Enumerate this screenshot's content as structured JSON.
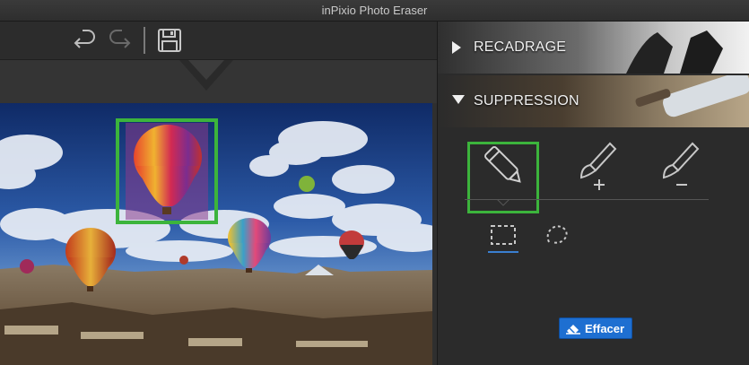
{
  "window": {
    "title": "inPixio Photo Eraser"
  },
  "toolbar": {
    "undo_icon": "undo-icon",
    "redo_icon": "redo-icon",
    "save_icon": "save-icon"
  },
  "panel": {
    "sections": [
      {
        "label": "RECADRAGE",
        "state": "collapsed"
      },
      {
        "label": "SUPPRESSION",
        "state": "expanded"
      }
    ],
    "tools": [
      "marker-tool-icon",
      "brush-add-icon",
      "brush-remove-icon"
    ],
    "modes": [
      "rectangle-select-icon",
      "lasso-select-icon"
    ],
    "erase_button": {
      "label": "Effacer",
      "icon": "eraser-icon"
    }
  },
  "colors": {
    "highlight": "#3cb43c",
    "accent": "#1e6fd1",
    "selection_fill": "#8a3a8c"
  }
}
